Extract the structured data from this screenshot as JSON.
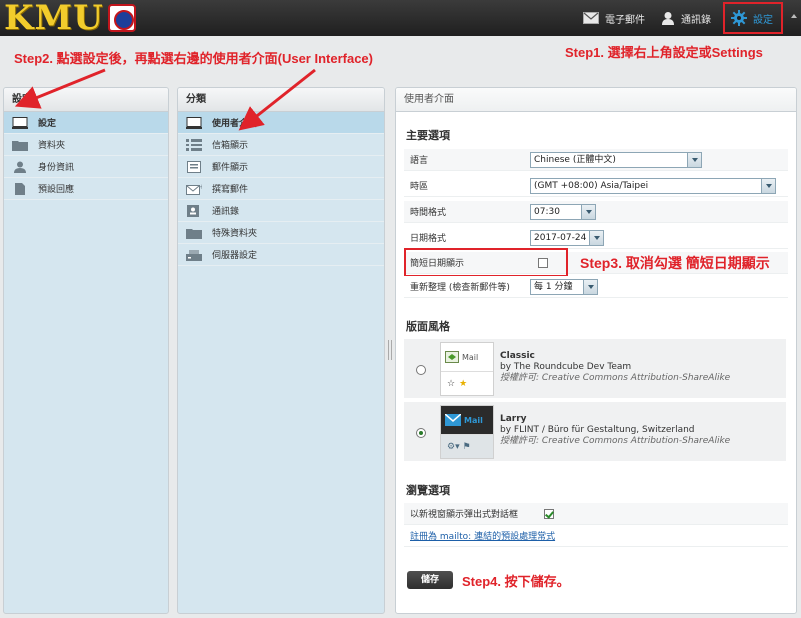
{
  "header": {
    "logo_text": "KMU",
    "nav": [
      {
        "label": "電子郵件",
        "icon": "mail-icon"
      },
      {
        "label": "通訊錄",
        "icon": "contacts-icon"
      },
      {
        "label": "設定",
        "icon": "gear-icon"
      }
    ]
  },
  "annotations": {
    "step1": "Step1. 選擇右上角設定或Settings",
    "step2": "Step2. 點選設定後，再點選右邊的使用者介面(User Interface)",
    "step3": "Step3. 取消勾選 簡短日期顯示",
    "step4": "Step4. 按下儲存。",
    "color": "#e0232a"
  },
  "settings_panel": {
    "title": "設定",
    "items": [
      {
        "label": "設定",
        "icon": "monitor-icon",
        "selected": true
      },
      {
        "label": "資料夾",
        "icon": "folder-icon"
      },
      {
        "label": "身份資訊",
        "icon": "person-icon"
      },
      {
        "label": "預設回應",
        "icon": "document-icon"
      }
    ]
  },
  "category_panel": {
    "title": "分類",
    "items": [
      {
        "label": "使用者介面",
        "icon": "monitor-icon",
        "selected": true
      },
      {
        "label": "信箱顯示",
        "icon": "list-icon"
      },
      {
        "label": "郵件顯示",
        "icon": "message-icon"
      },
      {
        "label": "撰寫郵件",
        "icon": "compose-icon"
      },
      {
        "label": "通訊錄",
        "icon": "addressbook-icon"
      },
      {
        "label": "特殊資料夾",
        "icon": "folder-icon"
      },
      {
        "label": "伺服器設定",
        "icon": "server-icon"
      }
    ]
  },
  "main": {
    "title": "使用者介面",
    "section_main": "主要選項",
    "rows": {
      "language": {
        "label": "語言",
        "value": "Chinese (正體中文)"
      },
      "timezone": {
        "label": "時區",
        "value": "(GMT +08:00) Asia/Taipei"
      },
      "time_format": {
        "label": "時間格式",
        "value": "07:30"
      },
      "date_format": {
        "label": "日期格式",
        "value": "2017-07-24"
      },
      "pretty_date": {
        "label": "簡短日期顯示",
        "checked": false
      },
      "refresh": {
        "label": "重新整理 (檢查新郵件等)",
        "value": "每 1 分鐘"
      }
    },
    "section_skin": "版面風格",
    "skins": [
      {
        "name": "Classic",
        "author": "by The Roundcube Dev Team",
        "license_label": "授權許可:",
        "license": "Creative Commons Attribution-ShareAlike",
        "thumb_text": "Mail",
        "selected": false
      },
      {
        "name": "Larry",
        "author": "by FLINT / Büro für Gestaltung, Switzerland",
        "license_label": "授權許可:",
        "license": "Creative Commons Attribution-ShareAlike",
        "thumb_text": "Mail",
        "selected": true
      }
    ],
    "section_browse": "瀏覽選項",
    "browse": {
      "popup_label": "以新視窗顯示彈出式對話框",
      "popup_checked": true,
      "mailto_link": "註冊為 mailto: 連結的預設處理常式"
    },
    "save_label": "儲存"
  }
}
